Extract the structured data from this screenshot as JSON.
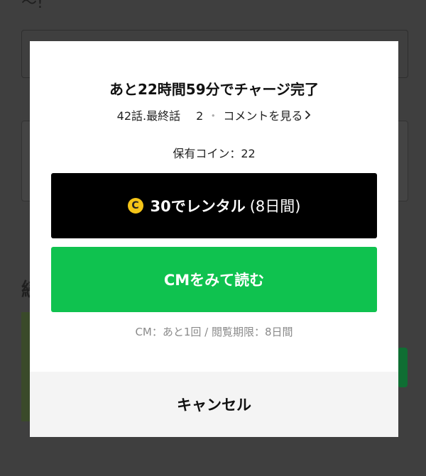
{
  "background": {
    "tilde": "～!",
    "heading": "続"
  },
  "modal": {
    "title": "あと22時間59分でチャージ完了",
    "episode": "42話.最終話",
    "comment_count": "2",
    "comment_link": "コメントを見る",
    "coins_label": "保有コイン：22",
    "rent_button": {
      "coin_icon": "C",
      "amount": "30でレンタル",
      "duration": "(8日間)"
    },
    "cm_button_label": "CMをみて読む",
    "cm_info": "CM：あと1回 / 閲覧期限：8日間",
    "cancel_label": "キャンセル"
  },
  "colors": {
    "rent_bg": "#000000",
    "cm_bg": "#0fc24f",
    "coin_icon": "#f5c518",
    "overlay": "#3f3f3f"
  }
}
